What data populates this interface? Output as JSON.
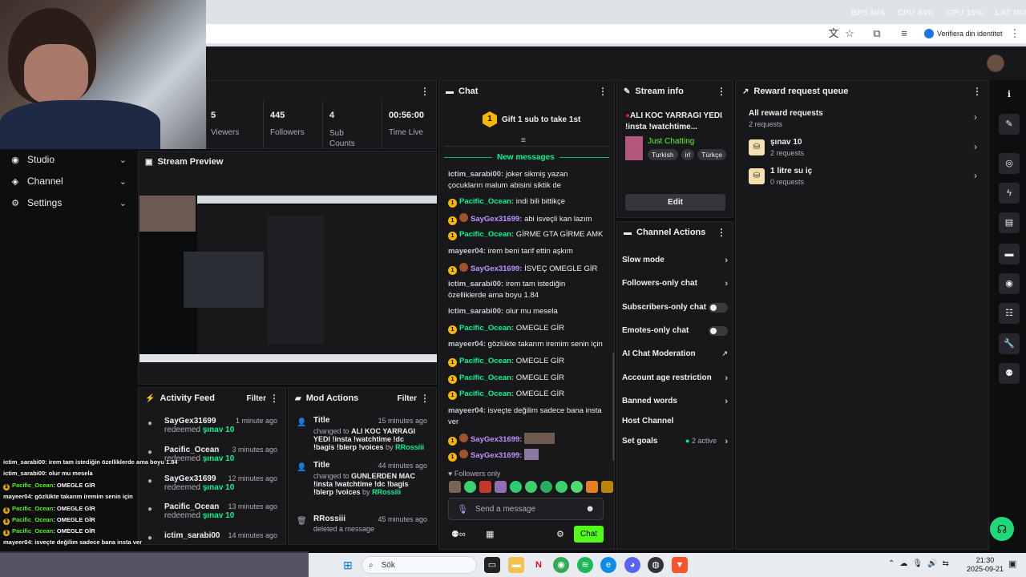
{
  "browser": {
    "stats": [
      "BPS N/A",
      "CPU 34%",
      "CPU 10%",
      "LAT N/A"
    ],
    "verify_label": "Verifiera din identitet"
  },
  "nav": {
    "items": [
      {
        "label": "Studio"
      },
      {
        "label": "Channel"
      },
      {
        "label": "Settings"
      }
    ]
  },
  "stats": {
    "viewers": {
      "value": "5",
      "label": "Viewers"
    },
    "followers": {
      "value": "445",
      "label": "Followers"
    },
    "subs": {
      "value": "4",
      "label": "Sub Counts"
    },
    "time": {
      "value": "00:56:00",
      "label": "Time Live"
    }
  },
  "preview": {
    "title": "Stream Preview"
  },
  "activity": {
    "title": "Activity Feed",
    "filter": "Filter",
    "items": [
      {
        "name": "SayGex31699",
        "time": "1 minute ago",
        "verb": "redeemed",
        "reward": "şınav 10"
      },
      {
        "name": "Pacific_Ocean",
        "time": "3 minutes ago",
        "verb": "redeemed",
        "reward": "şınav 10"
      },
      {
        "name": "SayGex31699",
        "time": "12 minutes ago",
        "verb": "redeemed",
        "reward": "şınav 10"
      },
      {
        "name": "Pacific_Ocean",
        "time": "13 minutes ago",
        "verb": "redeemed",
        "reward": "şınav 10"
      },
      {
        "name": "ictim_sarabi00",
        "time": "14 minutes ago"
      }
    ]
  },
  "mod": {
    "title": "Mod Actions",
    "filter": "Filter",
    "items": [
      {
        "title": "Title",
        "time": "15 minutes ago",
        "pre": "changed to",
        "body": "ALI KOC YARRAGI YEDI !insta !watchtime !dc !bagis !blerp !voices",
        "by_pre": "by",
        "by": "RRossiii"
      },
      {
        "title": "Title",
        "time": "44 minutes ago",
        "pre": "changed to",
        "body": "GUNLERDEN MAC !insta !watchtime !dc !bagis !blerp !voices",
        "by_pre": "by",
        "by": "RRossiii"
      },
      {
        "title": "RRossiii",
        "time": "45 minutes ago",
        "body": "deleted a message"
      }
    ]
  },
  "chat": {
    "title": "Chat",
    "gift": "Gift 1 sub to take 1st",
    "new_messages": "New messages",
    "lines": [
      {
        "user": "ictim_sarabi00:",
        "text": "joker sikmiş yazan çocukların malum abisini siktik de"
      },
      {
        "user": "Pacific_Ocean:",
        "text": "indi bili bittikçe"
      },
      {
        "user": "SayGex31699:",
        "text": "abi isveçli kan lazım"
      },
      {
        "user": "Pacific_Ocean:",
        "text": "GİRME GTA GİRME AMK"
      },
      {
        "user": "mayeer04:",
        "text": "irem beni tarif ettin aşkım"
      },
      {
        "user": "SayGex31699:",
        "text": "İSVEÇ OMEGLE GİR"
      },
      {
        "user": "ictim_sarabi00:",
        "text": "irem tam istediğin özelliklerde ama boyu 1.84"
      },
      {
        "user": "ictim_sarabi00:",
        "text": "olur mu mesela"
      },
      {
        "user": "Pacific_Ocean:",
        "text": "OMEGLE GİR"
      },
      {
        "user": "mayeer04:",
        "text": "gözlükte takarım iremim senin için"
      },
      {
        "user": "Pacific_Ocean:",
        "text": "OMEGLE GİR"
      },
      {
        "user": "Pacific_Ocean:",
        "text": "OMEGLE GİR"
      },
      {
        "user": "Pacific_Ocean:",
        "text": "OMEGLE GİR"
      },
      {
        "user": "mayeer04:",
        "text": "isveçte değilim sadece bana insta ver"
      },
      {
        "user": "SayGex31699:",
        "text": ""
      },
      {
        "user": "SayGex31699:",
        "text": ""
      }
    ],
    "followers_only": "Followers only",
    "placeholder": "Send a message",
    "send": "Chat"
  },
  "stream_info": {
    "title": "Stream info",
    "stream_title": "ALI KOC YARRAGI YEDI !insta !watchtime...",
    "category": "Just Chatting",
    "tags": [
      "Turkish",
      "irl",
      "Türkçe"
    ],
    "edit": "Edit"
  },
  "channel_actions": {
    "title": "Channel Actions",
    "rows": [
      {
        "label": "Slow mode"
      },
      {
        "label": "Followers-only chat"
      },
      {
        "label": "Subscribers-only chat"
      },
      {
        "label": "Emotes-only chat"
      },
      {
        "label": "AI Chat Moderation"
      },
      {
        "label": "Account age restriction"
      },
      {
        "label": "Banned words"
      },
      {
        "label": "Host Channel"
      },
      {
        "label": "Set goals",
        "extra": "2 active"
      }
    ]
  },
  "rewards": {
    "title": "Reward request queue",
    "all": {
      "title": "All reward requests",
      "sub": "2 requests"
    },
    "items": [
      {
        "title": "şınav 10",
        "sub": "2 requests"
      },
      {
        "title": "1 litre su iç",
        "sub": "0 requests"
      }
    ]
  },
  "overlay": {
    "lines": [
      {
        "user": "ictim_sarabi00",
        "text": ": irem tam istediğin özelliklerde ama boyu 1.84"
      },
      {
        "user": "ictim_sarabi00",
        "text": ": olur mu mesela"
      },
      {
        "user": "Pacific_Ocean",
        "text": ": OMEGLE GİR"
      },
      {
        "user": "mayeer04",
        "text": ": gözlükte takarım iremim senin için"
      },
      {
        "user": "Pacific_Ocean",
        "text": ": OMEGLE GİR"
      },
      {
        "user": "Pacific_Ocean",
        "text": ": OMEGLE GİR"
      },
      {
        "user": "Pacific_Ocean",
        "text": ": OMEGLE GİR"
      },
      {
        "user": "mayeer04",
        "text": ": isveçte değilim sadece bana insta ver"
      }
    ]
  },
  "taskbar": {
    "search": "Sök",
    "time": "21:30",
    "date": "2025-09-21"
  }
}
